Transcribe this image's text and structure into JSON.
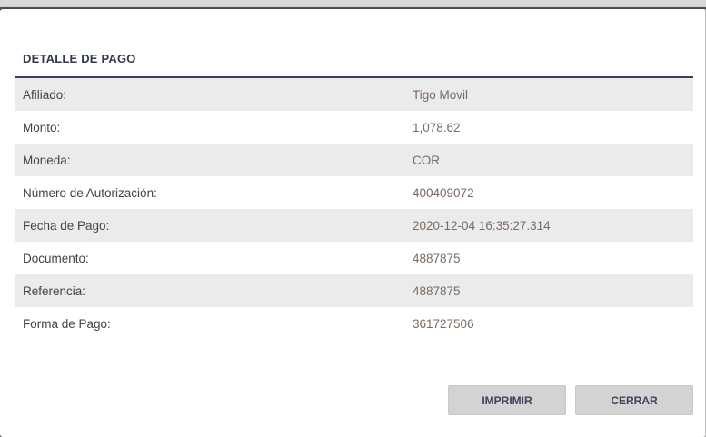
{
  "modal": {
    "title": "DETALLE DE PAGO"
  },
  "details": [
    {
      "label": "Afiliado:",
      "value": "Tigo Movil"
    },
    {
      "label": "Monto:",
      "value": "1,078.62"
    },
    {
      "label": "Moneda:",
      "value": "COR"
    },
    {
      "label": "Número de Autorización:",
      "value": "400409072"
    },
    {
      "label": "Fecha de Pago:",
      "value": "2020-12-04 16:35:27.314"
    },
    {
      "label": "Documento:",
      "value": "4887875"
    },
    {
      "label": "Referencia:",
      "value": "4887875"
    },
    {
      "label": "Forma de Pago:",
      "value": "361727506"
    }
  ],
  "buttons": {
    "print_label": "IMPRIMIR",
    "close_label": "CERRAR"
  },
  "colors": {
    "title": "#333a4d",
    "divider": "#3a4258",
    "row_alt": "#ebebeb",
    "value_text": "#7b6a5f",
    "button_bg": "#d3d3d3"
  }
}
